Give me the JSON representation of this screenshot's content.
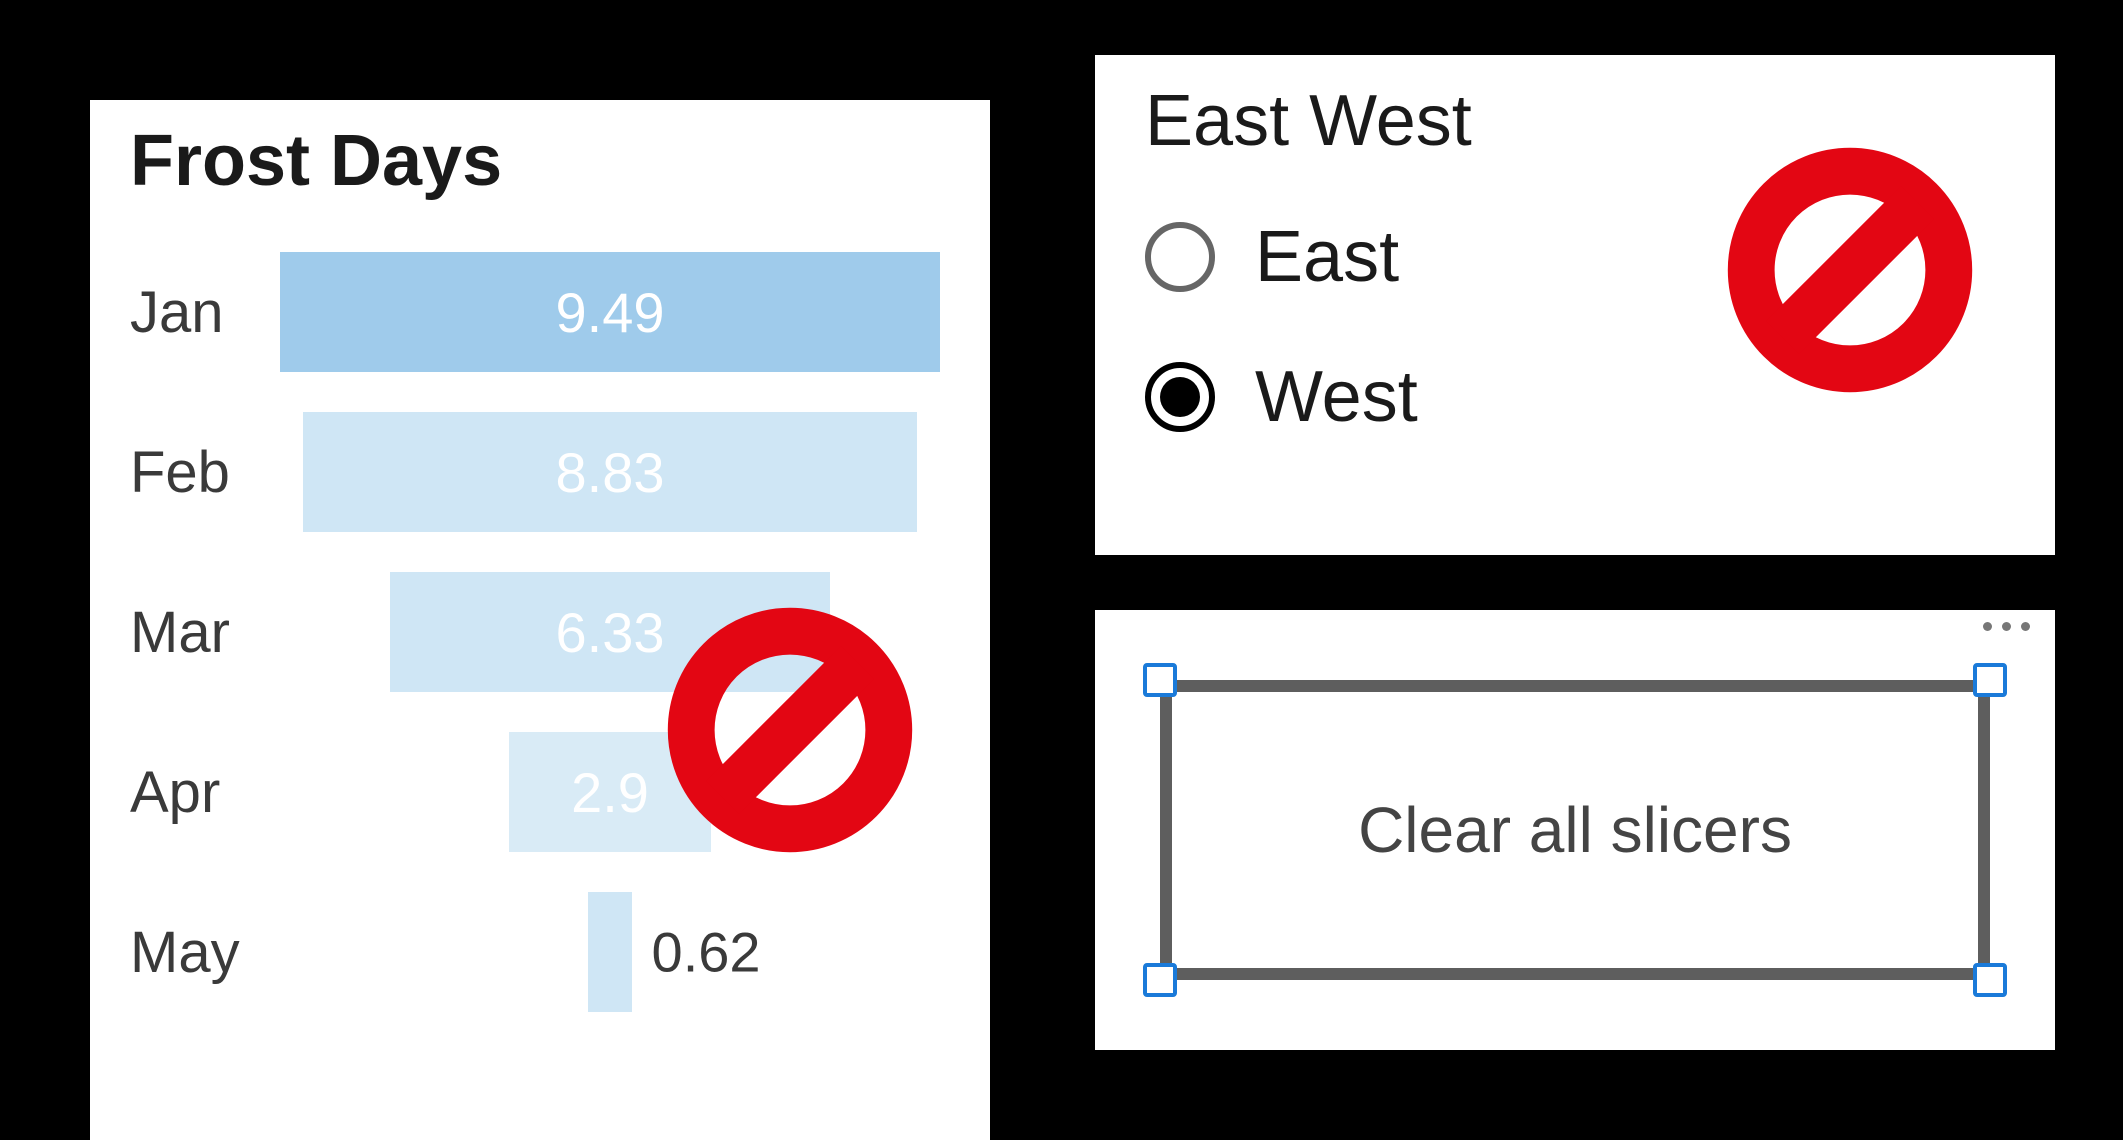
{
  "chart_data": {
    "type": "bar",
    "orientation": "horizontal-funnel",
    "title": "Frost Days",
    "categories": [
      "Jan",
      "Feb",
      "Mar",
      "Apr",
      "May"
    ],
    "values": [
      9.49,
      8.83,
      6.33,
      2.9,
      0.62
    ],
    "max": 9.49
  },
  "funnel": {
    "title": "Frost Days",
    "bars": [
      {
        "category": "Jan",
        "value": "9.49",
        "label_outside": false,
        "color": "#9FCBEB"
      },
      {
        "category": "Feb",
        "value": "8.83",
        "label_outside": false,
        "color": "#CFE6F5"
      },
      {
        "category": "Mar",
        "value": "6.33",
        "label_outside": false,
        "color": "#CFE6F5"
      },
      {
        "category": "Apr",
        "value": "2.9",
        "label_outside": false,
        "color": "#D9EBF6"
      },
      {
        "category": "May",
        "value": "0.62",
        "label_outside": true,
        "color": "#CFE6F5"
      }
    ]
  },
  "slicer": {
    "title": "East West",
    "options": [
      {
        "label": "East",
        "selected": false
      },
      {
        "label": "West",
        "selected": true
      }
    ]
  },
  "button": {
    "label": "Clear all slicers"
  },
  "annotations": {
    "prohibit_left": "no-icon",
    "prohibit_right": "no-icon"
  },
  "colors": {
    "prohibit": "#E30613",
    "selection_handle_border": "#1A7AD9",
    "selection_frame": "#5E5E5E"
  }
}
